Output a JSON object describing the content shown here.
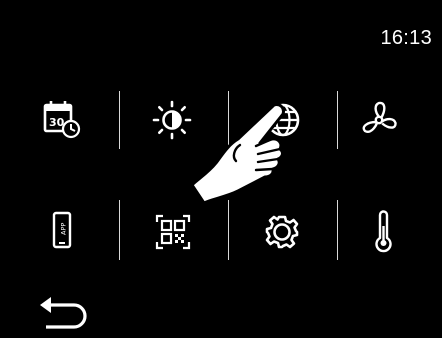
{
  "status": {
    "time": "16:13"
  },
  "grid": {
    "row1": [
      {
        "id": "calendar-timer",
        "icon": "calendar-clock-icon",
        "text": "30"
      },
      {
        "id": "brightness",
        "icon": "brightness-icon"
      },
      {
        "id": "language",
        "icon": "globe-icon"
      },
      {
        "id": "fan",
        "icon": "fan-icon"
      }
    ],
    "row2": [
      {
        "id": "app",
        "icon": "app-phone-icon",
        "text": "APP"
      },
      {
        "id": "qr-code",
        "icon": "qr-code-icon"
      },
      {
        "id": "settings",
        "icon": "gear-icon"
      },
      {
        "id": "temperature",
        "icon": "thermometer-icon"
      }
    ]
  },
  "nav": {
    "back_icon": "back-arrow-icon"
  },
  "overlay": {
    "icon": "pointing-hand-icon",
    "target": "language"
  }
}
